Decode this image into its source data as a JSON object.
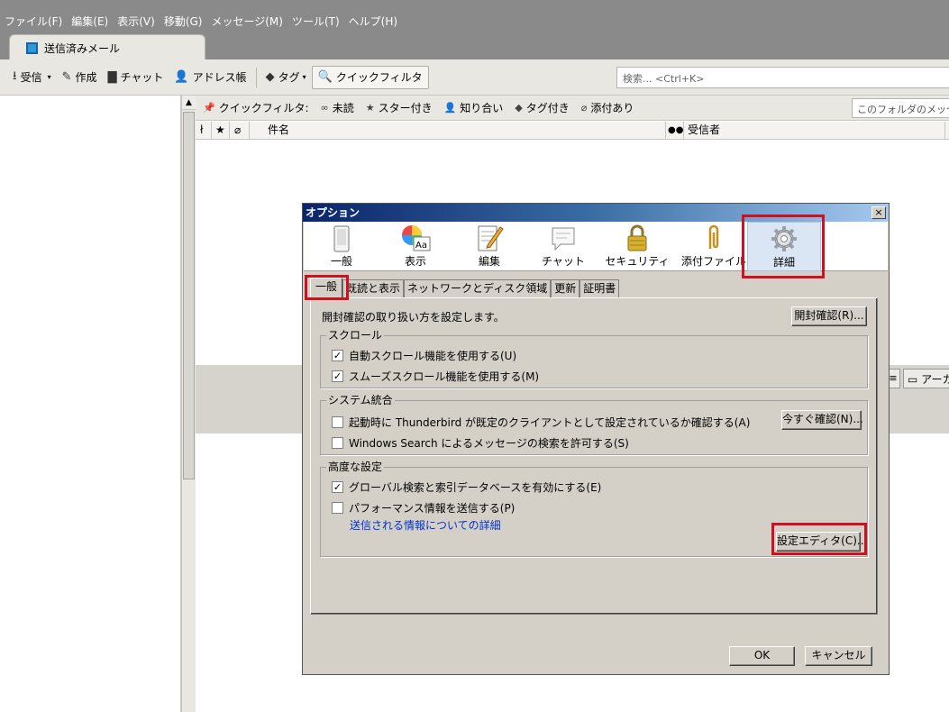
{
  "menubar": [
    "ファイル(F)",
    "編集(E)",
    "表示(V)",
    "移動(G)",
    "メッセージ(M)",
    "ツール(T)",
    "ヘルプ(H)"
  ],
  "tab": {
    "label": "送信済みメール"
  },
  "toolbar": {
    "receive": "受信",
    "compose": "作成",
    "chat": "チャット",
    "addressbook": "アドレス帳",
    "tag": "タグ",
    "quickfilter": "クイックフィルタ",
    "search_placeholder": "検索... <Ctrl+K>"
  },
  "quickfilter_bar": {
    "label": "クイックフィルタ:",
    "unread": "未読",
    "starred": "スター付き",
    "contacts": "知り合い",
    "tagged": "タグ付き",
    "attachments": "添付あり",
    "search_placeholder": "このフォルダのメッセージ"
  },
  "columns": {
    "subject": "件名",
    "recipient": "受信者"
  },
  "archive_button": "アーカ",
  "dialog": {
    "title": "オプション",
    "close": "×",
    "panes": [
      "一般",
      "表示",
      "編集",
      "チャット",
      "セキュリティ",
      "添付ファイル",
      "詳細"
    ],
    "subtabs": [
      "一般",
      "既読と表示",
      "ネットワークとディスク領域",
      "更新",
      "証明書"
    ],
    "receipt_text": "開封確認の取り扱い方を設定します。",
    "receipt_button": "開封確認(R)...",
    "scroll_group": "スクロール",
    "auto_scroll": "自動スクロール機能を使用する(U)",
    "smooth_scroll": "スムーズスクロール機能を使用する(M)",
    "system_group": "システム統合",
    "default_client": "起動時に Thunderbird が既定のクライアントとして設定されているか確認する(A)",
    "check_now_button": "今すぐ確認(N)...",
    "windows_search": "Windows Search によるメッセージの検索を許可する(S)",
    "advanced_group": "高度な設定",
    "global_search": "グローバル検索と索引データベースを有効にする(E)",
    "performance": "パフォーマンス情報を送信する(P)",
    "performance_link": "送信される情報についての詳細",
    "config_editor_button": "設定エディタ(C)...",
    "ok": "OK",
    "cancel": "キャンセル"
  },
  "checks": {
    "auto_scroll": true,
    "smooth_scroll": true,
    "default_client": false,
    "windows_search": false,
    "global_search": true,
    "performance": false
  },
  "highlight_color": "#d0101e"
}
